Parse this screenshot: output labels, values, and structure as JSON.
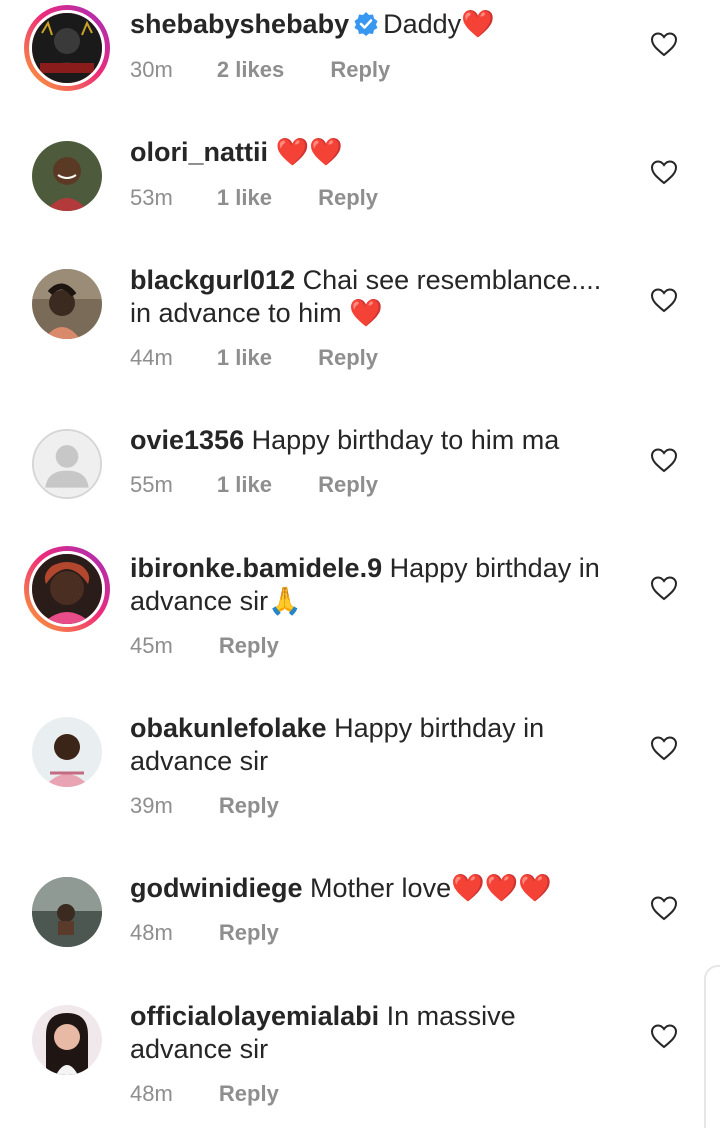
{
  "colors": {
    "heart": "#e0112b",
    "meta": "#8e8e8e",
    "verified": "#3897f0",
    "text": "#262626"
  },
  "icons": {
    "like": "heart-outline-icon",
    "verified": "verified-badge-icon"
  },
  "comments": [
    {
      "username": "shebabyshebaby",
      "verified": true,
      "text": "Daddy",
      "hearts": "❤️",
      "time": "30m",
      "likes": "2 likes",
      "reply": "Reply"
    },
    {
      "username": "olori_nattii",
      "text": "",
      "hearts": "❤️❤️",
      "time": "53m",
      "likes": "1 like",
      "reply": "Reply"
    },
    {
      "username": "blackgurl012",
      "text": "Chai see resemblance.... in advance to him",
      "hearts": "❤️",
      "time": "44m",
      "likes": "1 like",
      "reply": "Reply"
    },
    {
      "username": "ovie1356",
      "text": "Happy birthday to him ma",
      "hearts": "",
      "time": "55m",
      "likes": "1 like",
      "reply": "Reply"
    },
    {
      "username": "ibironke.bamidele.9",
      "text": "Happy birthday in advance sir🙏",
      "hearts": "",
      "time": "45m",
      "likes": "",
      "reply": "Reply"
    },
    {
      "username": "obakunlefolake",
      "text": "Happy birthday in advance sir",
      "hearts": "",
      "time": "39m",
      "likes": "",
      "reply": "Reply"
    },
    {
      "username": "godwinidiege",
      "text": "Mother love",
      "hearts": "❤️❤️❤️",
      "time": "48m",
      "likes": "",
      "reply": "Reply"
    },
    {
      "username": "officialolayemialabi",
      "text": "In massive advance sir",
      "hearts": "",
      "time": "48m",
      "likes": "",
      "reply": "Reply"
    }
  ]
}
